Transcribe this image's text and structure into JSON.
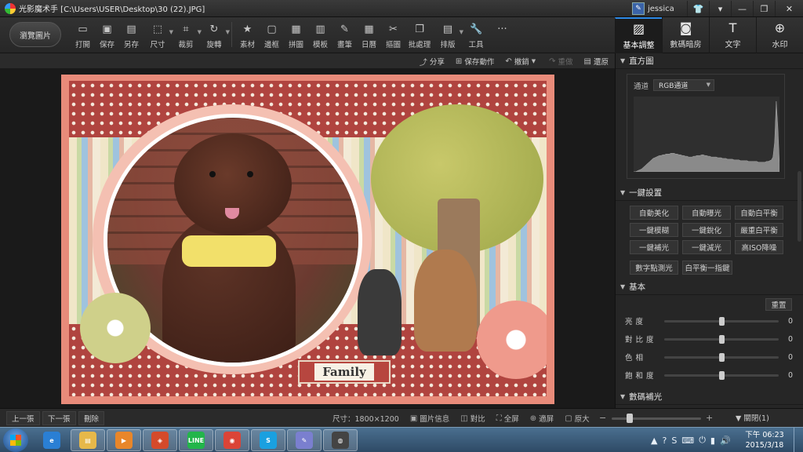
{
  "window": {
    "title": "光影魔术手 [C:\\Users\\USER\\Desktop\\30 (22).JPG]",
    "user": "jessica",
    "controls": {
      "min": "—",
      "max": "❐",
      "close": "✕"
    }
  },
  "toolbar": {
    "browse_label": "瀏覽圖片",
    "tools": [
      {
        "name": "open",
        "label": "打開",
        "icon": "folder-icon"
      },
      {
        "name": "save",
        "label": "保存",
        "icon": "save-icon"
      },
      {
        "name": "save-as",
        "label": "另存",
        "icon": "save-as-icon"
      },
      {
        "name": "size",
        "label": "尺寸",
        "icon": "resize-icon"
      },
      {
        "name": "crop",
        "label": "裁剪",
        "icon": "crop-icon"
      },
      {
        "name": "rotate",
        "label": "旋轉",
        "icon": "rotate-icon"
      },
      {
        "name": "material",
        "label": "素材",
        "icon": "star-icon"
      },
      {
        "name": "border",
        "label": "邊框",
        "icon": "frame-icon"
      },
      {
        "name": "collage",
        "label": "拼圖",
        "icon": "grid-icon"
      },
      {
        "name": "template",
        "label": "模板",
        "icon": "template-icon"
      },
      {
        "name": "brush",
        "label": "畫筆",
        "icon": "brush-icon"
      },
      {
        "name": "calendar",
        "label": "日曆",
        "icon": "calendar-icon"
      },
      {
        "name": "cutout",
        "label": "摳圖",
        "icon": "cutout-icon"
      },
      {
        "name": "batch",
        "label": "批處理",
        "icon": "batch-icon"
      },
      {
        "name": "layout",
        "label": "排版",
        "icon": "layout-icon"
      },
      {
        "name": "tools",
        "label": "工具",
        "icon": "wrench-icon"
      }
    ],
    "more": "···",
    "right_tabs": [
      {
        "label": "基本調整",
        "icon": "adjust-icon",
        "active": true
      },
      {
        "label": "數碼暗房",
        "icon": "camera-icon",
        "active": false
      },
      {
        "label": "文字",
        "icon": "text-icon",
        "active": false
      },
      {
        "label": "水印",
        "icon": "watermark-icon",
        "active": false
      }
    ]
  },
  "actionbar": {
    "share": "分享",
    "save_action": "保存動作",
    "undo": "撤銷",
    "redo": "重做",
    "restore": "還原"
  },
  "canvas": {
    "tag_text": "Family"
  },
  "panel": {
    "histogram": {
      "title": "直方圖",
      "channel_label": "通道",
      "channel_value": "RGB通道",
      "levels": [
        0,
        0,
        1,
        2,
        3,
        4,
        6,
        8,
        10,
        12,
        14,
        16,
        18,
        19,
        20,
        21,
        22,
        22,
        23,
        23,
        24,
        24,
        24,
        25,
        25,
        25,
        24,
        24,
        23,
        23,
        22,
        22,
        21,
        21,
        20,
        20,
        20,
        21,
        21,
        22,
        22,
        22,
        23,
        23,
        22,
        22,
        21,
        21,
        20,
        20,
        20,
        20,
        19,
        19,
        19,
        18,
        18,
        18,
        17,
        17,
        17,
        17,
        16,
        16,
        16,
        16,
        15,
        15,
        15,
        15,
        15,
        14,
        14,
        14,
        14,
        14,
        14,
        13,
        13,
        13,
        13,
        13,
        14,
        14,
        15,
        16,
        20,
        40,
        95,
        60,
        10
      ]
    },
    "one_click": {
      "title": "一鍵設置",
      "rows": [
        [
          "自動美化",
          "自動曝光",
          "自動白平衡"
        ],
        [
          "一鍵模糊",
          "一鍵銳化",
          "嚴重白平衡"
        ],
        [
          "一鍵補光",
          "一鍵減光",
          "高ISO降噪"
        ],
        [
          "數字點測光",
          "白平衡一指鍵"
        ]
      ]
    },
    "basic": {
      "title": "基本",
      "reset": "重置",
      "sliders": [
        {
          "label": "亮度",
          "value": "0",
          "level": 0.5
        },
        {
          "label": "對比度",
          "value": "0",
          "level": 0.5
        },
        {
          "label": "色相",
          "value": "0",
          "level": 0.5
        },
        {
          "label": "飽和度",
          "value": "0",
          "level": 0.5
        }
      ],
      "next_section": "數碼補光"
    }
  },
  "statusbar": {
    "prev": "上一張",
    "next": "下一張",
    "delete": "刪除",
    "size_label": "尺寸：1800×1200",
    "info": "圖片信息",
    "compare": "對比",
    "fullscreen": "全屏",
    "fit": "適屏",
    "original": "原大",
    "zoom_minus": "−",
    "zoom_plus": "+",
    "zoom_level": 0.18,
    "close": "▼ 關閉(1)"
  },
  "taskbar": {
    "apps": [
      {
        "name": "ie",
        "glyph": "e",
        "color": "#2a7fd4",
        "open": false
      },
      {
        "name": "explorer",
        "glyph": "▤",
        "color": "#e6b84a",
        "open": true
      },
      {
        "name": "media",
        "glyph": "▶",
        "color": "#e8862a",
        "open": true
      },
      {
        "name": "photo",
        "glyph": "◈",
        "color": "#d44a2a",
        "open": true
      },
      {
        "name": "line",
        "glyph": "LINE",
        "color": "#22b54a",
        "open": true
      },
      {
        "name": "chrome",
        "glyph": "◉",
        "color": "#db4437",
        "open": true
      },
      {
        "name": "skype",
        "glyph": "S",
        "color": "#1aa0e0",
        "open": true
      },
      {
        "name": "paint",
        "glyph": "✎",
        "color": "#7a7fcf",
        "open": true
      },
      {
        "name": "neoimaging",
        "glyph": "◍",
        "color": "#444",
        "open": true
      }
    ],
    "time": "下午 06:23",
    "date": "2015/3/18"
  }
}
